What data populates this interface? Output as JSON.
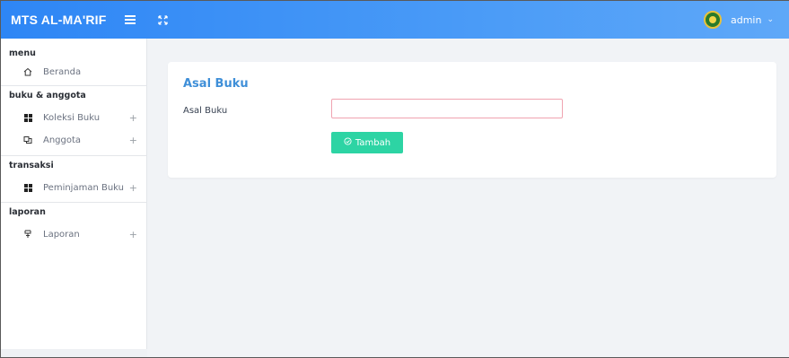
{
  "topbar": {
    "brand": "MTS AL-MA'RIF",
    "menu_icon": "hamburger-icon",
    "expand_icon": "fullscreen-icon",
    "user": {
      "name": "admin",
      "avatar_icon": "school-logo-icon",
      "caret_icon": "chevron-down-icon"
    }
  },
  "sidebar": {
    "sections": [
      {
        "title": "menu",
        "items": [
          {
            "label": "Beranda",
            "icon": "home-icon",
            "expandable": false
          }
        ]
      },
      {
        "title": "buku & anggota",
        "items": [
          {
            "label": "Koleksi Buku",
            "icon": "grid-icon",
            "expandable": true
          },
          {
            "label": "Anggota",
            "icon": "members-icon",
            "expandable": true
          }
        ]
      },
      {
        "title": "transaksi",
        "items": [
          {
            "label": "Peminjaman Buku",
            "icon": "grid-icon",
            "expandable": true
          }
        ]
      },
      {
        "title": "laporan",
        "items": [
          {
            "label": "Laporan",
            "icon": "report-icon",
            "expandable": true
          }
        ]
      }
    ]
  },
  "main": {
    "card_title": "Asal Buku",
    "field_label": "Asal Buku",
    "field_value": "",
    "field_placeholder": "",
    "submit_label": "Tambah",
    "submit_icon": "check-circle-icon"
  },
  "colors": {
    "topbar_start": "#2e86f5",
    "topbar_end": "#5fa8f8",
    "title": "#3f8fd8",
    "button": "#2dd4a4",
    "input_border": "#f0a3b0"
  }
}
